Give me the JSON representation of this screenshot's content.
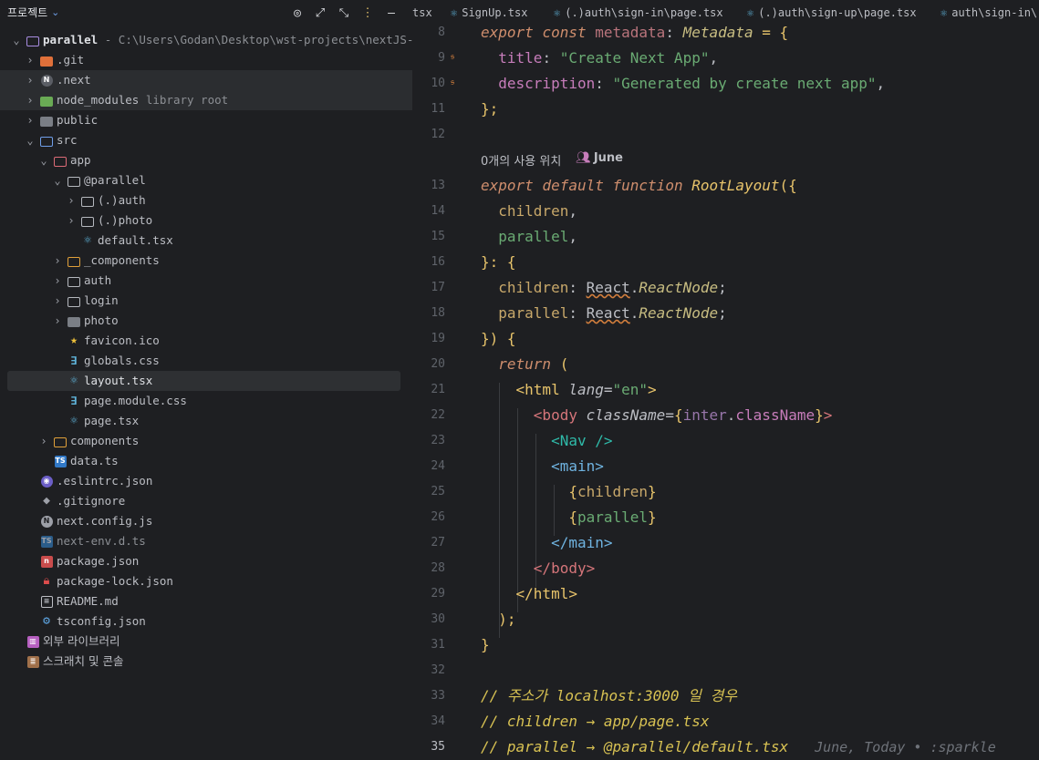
{
  "panel": {
    "title": "프로젝트",
    "chevron": "chevron-down-icon"
  },
  "tree": [
    {
      "name": "root",
      "label": "parallel",
      "hint": " - C:\\Users\\Godan\\Desktop\\wst-projects\\nextJS-st"
    },
    {
      "label": ".git"
    },
    {
      "label": ".next"
    },
    {
      "label": "node_modules",
      "hint": " library root"
    },
    {
      "label": "public"
    },
    {
      "label": "src"
    },
    {
      "label": "app"
    },
    {
      "label": "@parallel"
    },
    {
      "label": "(.)auth"
    },
    {
      "label": "(.)photo"
    },
    {
      "label": "default.tsx"
    },
    {
      "label": "_components"
    },
    {
      "label": "auth"
    },
    {
      "label": "login"
    },
    {
      "label": "photo"
    },
    {
      "label": "favicon.ico"
    },
    {
      "label": "globals.css"
    },
    {
      "label": "layout.tsx"
    },
    {
      "label": "page.module.css"
    },
    {
      "label": "page.tsx"
    },
    {
      "label": "components"
    },
    {
      "label": "data.ts"
    },
    {
      "label": ".eslintrc.json"
    },
    {
      "label": ".gitignore"
    },
    {
      "label": "next.config.js"
    },
    {
      "label": "next-env.d.ts"
    },
    {
      "label": "package.json"
    },
    {
      "label": "package-lock.json"
    },
    {
      "label": "README.md"
    },
    {
      "label": "tsconfig.json"
    },
    {
      "label": "외부 라이브러리"
    },
    {
      "label": "스크래치 및 콘솔"
    }
  ],
  "tabs": [
    {
      "label": "tsx"
    },
    {
      "label": "SignUp.tsx"
    },
    {
      "label": "(.)auth\\sign-in\\page.tsx"
    },
    {
      "label": "(.)auth\\sign-up\\page.tsx"
    },
    {
      "label": "auth\\sign-in\\"
    }
  ],
  "editor": {
    "line_numbers": [
      "8",
      "9",
      "10",
      "11",
      "12",
      "13",
      "14",
      "15",
      "16",
      "17",
      "18",
      "19",
      "20",
      "21",
      "22",
      "23",
      "24",
      "25",
      "26",
      "27",
      "28",
      "29",
      "30",
      "31",
      "32",
      "33",
      "34",
      "35"
    ],
    "current_line": "35",
    "usage_hint": "0개의 사용 위치",
    "author": "June",
    "blame": "June, Today • :sparkle",
    "code": {
      "l8_kw1": "export",
      "l8_kw2": "const",
      "l8_name": "metadata",
      "l8_type": "Metadata",
      "l8_rest": " = {",
      "l9_prop": "title",
      "l9_str": "\"Create Next App\"",
      "l10_prop": "description",
      "l10_str": "\"Generated by create next app\"",
      "l11": "};",
      "l13_kw1": "export",
      "l13_kw2": "default",
      "l13_kw3": "function",
      "l13_fn": "RootLayout",
      "l13_rest": "({",
      "l14": "children",
      "l15": "parallel",
      "l16": "}: {",
      "l17_prop": "children",
      "l17_ns": "React",
      "l17_type": "ReactNode",
      "l18_prop": "parallel",
      "l18_ns": "React",
      "l18_type": "ReactNode",
      "l19": "}) {",
      "l20_kw": "return",
      "l20_rest": " (",
      "l21_tag": "<html",
      "l21_attr": "lang",
      "l21_val": "\"en\"",
      "l21_end": ">",
      "l22_tag": "<body",
      "l22_attr": "className",
      "l22_obj": "inter",
      "l22_prop": "className",
      "l22_end": ">",
      "l23_tag": "<Nav",
      "l23_end": "/>",
      "l24_tag": "<main>",
      "l25": "children",
      "l26": "parallel",
      "l27_tag": "</main>",
      "l28_tag": "</body>",
      "l29_tag": "</html>",
      "l30": ");",
      "l31": "}",
      "l33": "// 주소가 localhost:3000 일 경우",
      "l34": "// children → app/page.tsx",
      "l35": "// parallel → @parallel/default.tsx"
    }
  }
}
